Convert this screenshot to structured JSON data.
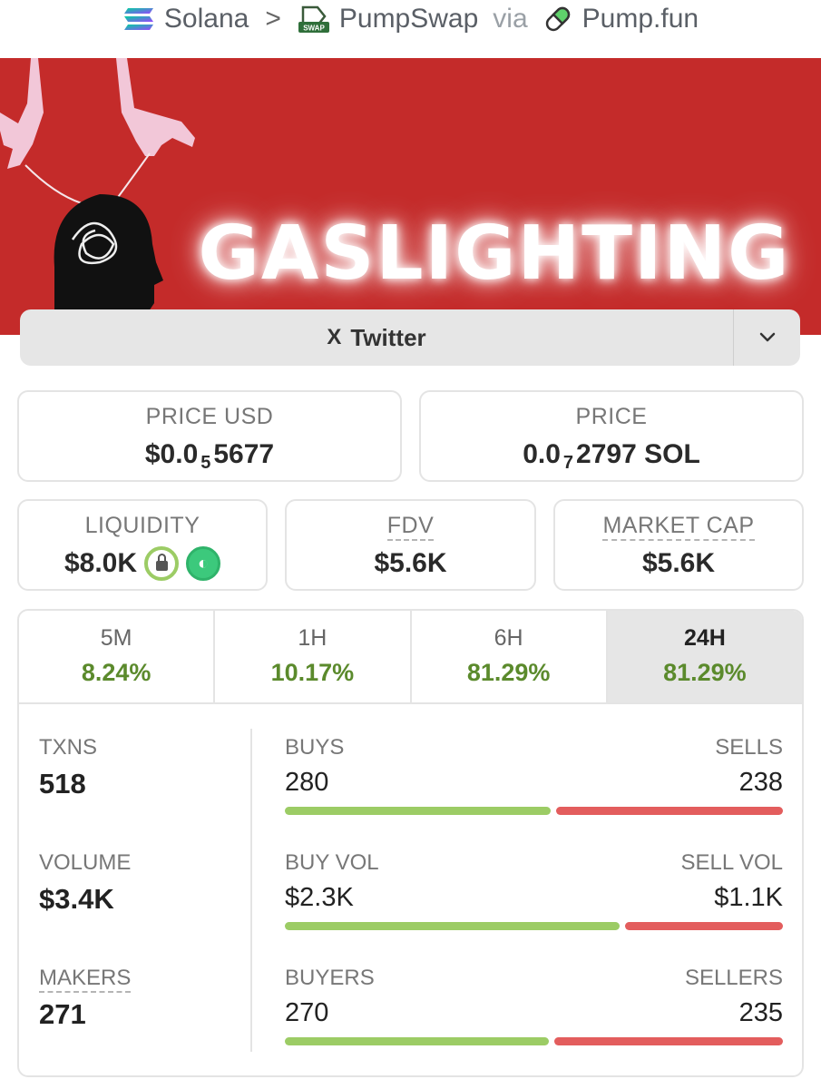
{
  "breadcrumb": {
    "chain": "Solana",
    "separator": ">",
    "dex": "PumpSwap",
    "via": "via",
    "launchpad": "Pump.fun",
    "chain_icon": "solana-icon",
    "dex_icon": "pumpswap-icon",
    "launchpad_icon": "pill-icon",
    "swap_badge": "SWAP"
  },
  "banner": {
    "title": "GASLIGHTING",
    "background_color": "#c42b2a"
  },
  "social": {
    "twitter_icon": "X",
    "twitter_label": "Twitter",
    "more_icon": "chevron-down-icon"
  },
  "prices": {
    "price_usd_label": "PRICE USD",
    "price_usd_prefix": "$0.0",
    "price_usd_zeros": "5",
    "price_usd_digits": "5677",
    "price_label": "PRICE",
    "price_sol_prefix": "0.0",
    "price_sol_zeros": "7",
    "price_sol_digits": "2797 SOL"
  },
  "metrics": {
    "liquidity_label": "LIQUIDITY",
    "liquidity_value": "$8.0K",
    "fdv_label": "FDV",
    "fdv_value": "$5.6K",
    "mcap_label": "MARKET CAP",
    "mcap_value": "$5.6K"
  },
  "timeframes": [
    {
      "label": "5M",
      "change": "8.24%",
      "active": false
    },
    {
      "label": "1H",
      "change": "10.17%",
      "active": false
    },
    {
      "label": "6H",
      "change": "81.29%",
      "active": false
    },
    {
      "label": "24H",
      "change": "81.29%",
      "active": true
    }
  ],
  "stats": {
    "txns_label": "TXNS",
    "txns_value": "518",
    "volume_label": "VOLUME",
    "volume_value": "$3.4K",
    "makers_label": "MAKERS",
    "makers_value": "271"
  },
  "ratios": [
    {
      "left_label": "BUYS",
      "right_label": "SELLS",
      "left_value": "280",
      "right_value": "238",
      "left_share": 0.54
    },
    {
      "left_label": "BUY VOL",
      "right_label": "SELL VOL",
      "left_value": "$2.3K",
      "right_value": "$1.1K",
      "left_share": 0.68
    },
    {
      "left_label": "BUYERS",
      "right_label": "SELLERS",
      "left_value": "270",
      "right_value": "235",
      "left_share": 0.535
    }
  ],
  "colors": {
    "positive": "#5b8a2c",
    "buy_bar": "#9ccc65",
    "sell_bar": "#e35d5d"
  }
}
